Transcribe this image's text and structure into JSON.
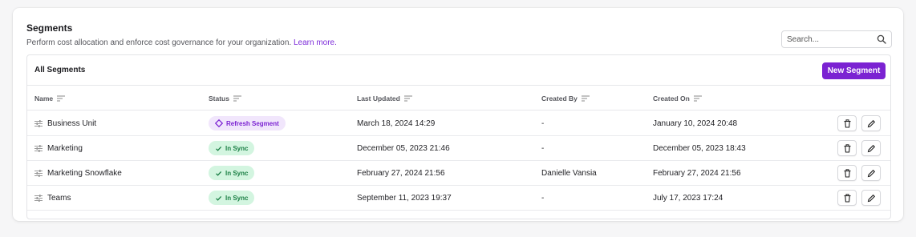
{
  "header": {
    "title": "Segments",
    "subtitle": "Perform cost allocation and enforce cost governance for your organization.",
    "learn_more": "Learn more."
  },
  "search": {
    "placeholder": "Search...",
    "icon": "search-icon"
  },
  "table_box": {
    "title": "All Segments",
    "new_button": "New Segment",
    "columns": [
      "Name",
      "Status",
      "Last Updated",
      "Created By",
      "Created On"
    ]
  },
  "rows": [
    {
      "name": "Business Unit",
      "status": "Refresh Segment",
      "status_kind": "refresh",
      "last_updated": "March 18, 2024 14:29",
      "created_by": "-",
      "created_on": "January 10, 2024 20:48"
    },
    {
      "name": "Marketing",
      "status": "In Sync",
      "status_kind": "sync",
      "last_updated": "December 05, 2023 21:46",
      "created_by": "-",
      "created_on": "December 05, 2023 18:43"
    },
    {
      "name": "Marketing Snowflake",
      "status": "In Sync",
      "status_kind": "sync",
      "last_updated": "February 27, 2024 21:56",
      "created_by": "Danielle Vansia",
      "created_on": "February 27, 2024 21:56"
    },
    {
      "name": "Teams",
      "status": "In Sync",
      "status_kind": "sync",
      "last_updated": "September 11, 2023 19:37",
      "created_by": "-",
      "created_on": "July 17, 2023 17:24"
    }
  ],
  "colors": {
    "accent": "#7b22d2",
    "sync_bg": "#d3f5e0",
    "sync_text": "#1b7f45",
    "refresh_bg": "#f1e6fc"
  }
}
